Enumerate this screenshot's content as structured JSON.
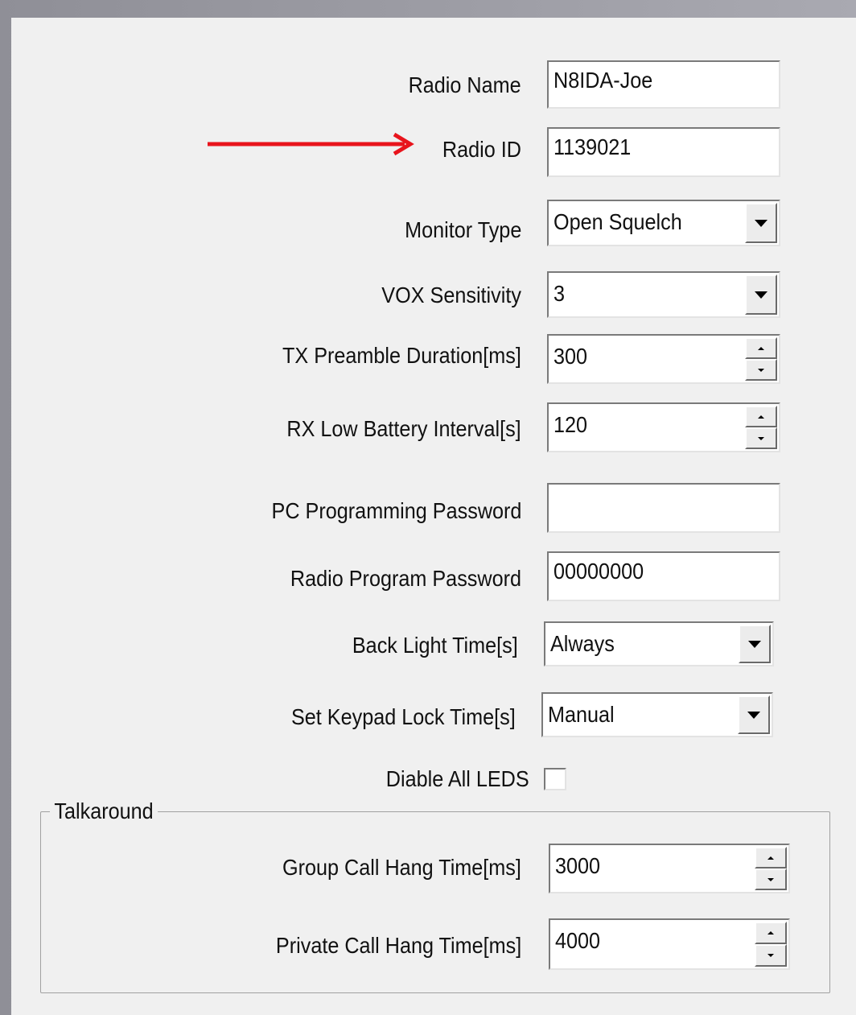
{
  "form": {
    "radio_name": {
      "label": "Radio Name",
      "value": "N8IDA-Joe"
    },
    "radio_id": {
      "label": "Radio ID",
      "value": "1139021"
    },
    "monitor_type": {
      "label": "Monitor Type",
      "value": "Open Squelch"
    },
    "vox_sensitivity": {
      "label": "VOX Sensitivity",
      "value": "3"
    },
    "tx_preamble": {
      "label": "TX Preamble Duration[ms]",
      "value": "300"
    },
    "rx_low_battery": {
      "label": "RX Low Battery Interval[s]",
      "value": "120"
    },
    "pc_password": {
      "label": "PC Programming Password",
      "value": ""
    },
    "radio_password": {
      "label": "Radio Program Password",
      "value": "00000000"
    },
    "back_light": {
      "label": "Back Light Time[s]",
      "value": "Always"
    },
    "keypad_lock": {
      "label": "Set Keypad Lock Time[s]",
      "value": "Manual"
    },
    "disable_leds": {
      "label": "Diable All LEDS",
      "checked": false
    }
  },
  "talkaround": {
    "title": "Talkaround",
    "group_call": {
      "label": "Group Call Hang Time[ms]",
      "value": "3000"
    },
    "private_call": {
      "label": "Private Call Hang Time[ms]",
      "value": "4000"
    }
  },
  "annotation": {
    "arrow_color": "#e8141c"
  },
  "icons": [
    "dropdown-arrow-icon",
    "spin-up-icon",
    "spin-down-icon",
    "annotation-arrow-icon"
  ]
}
